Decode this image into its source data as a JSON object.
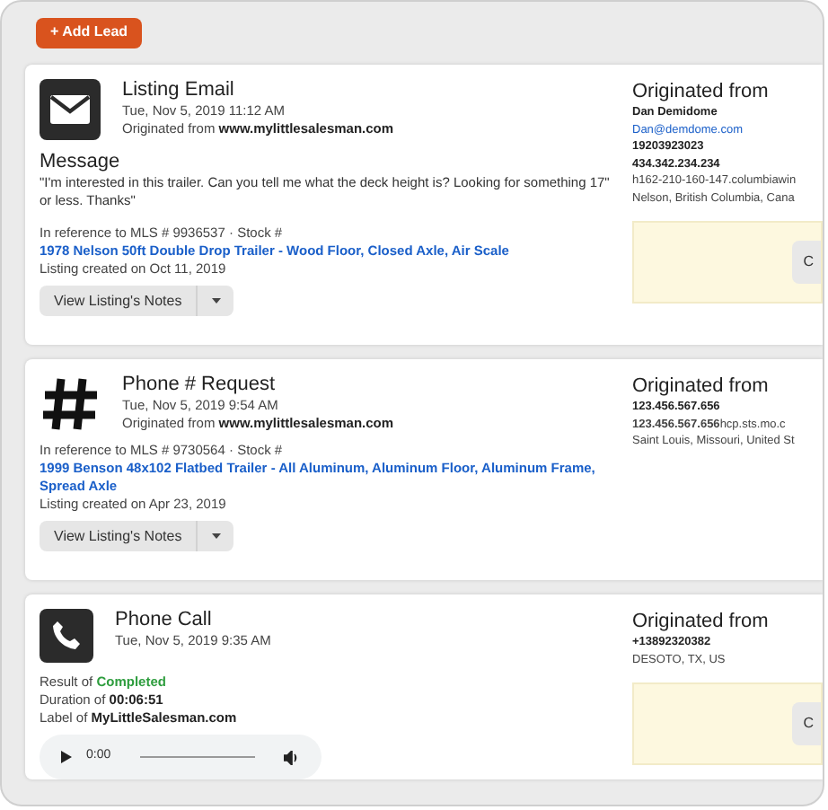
{
  "add_button": "+ Add Lead",
  "leads": [
    {
      "kind": "email",
      "title": "Listing Email",
      "date": "Tue, Nov 5, 2019 11:12 AM",
      "origin_prefix": "Originated from",
      "origin_site": "www.mylittlesalesman.com",
      "message_heading": "Message",
      "message": "\"I'm interested in this trailer. Can you tell me what the deck height is? Looking for something 17\" or less. Thanks\"",
      "reference": "In reference to MLS # 9936537 · Stock #",
      "listing_link": "1978 Nelson 50ft Double Drop Trailer - Wood Floor, Closed Axle, Air Scale",
      "listing_created": "Listing created on Oct 11, 2019",
      "notes_button": "View Listing's Notes",
      "originated_heading": "Originated from",
      "originated_lines": [
        {
          "kind": "bold",
          "text": "Dan Demidome"
        },
        {
          "kind": "link",
          "text": "Dan@demdome.com"
        },
        {
          "kind": "bold",
          "text": "19203923023"
        },
        {
          "kind": "bold",
          "text": "434.342.234.234"
        },
        {
          "kind": "plain",
          "text": "h162-210-160-147.columbiawin"
        },
        {
          "kind": "plain",
          "text": "Nelson, British Columbia, Cana"
        }
      ],
      "note_button": "C"
    },
    {
      "kind": "request",
      "title": "Phone # Request",
      "date": "Tue, Nov 5, 2019 9:54 AM",
      "origin_prefix": "Originated from",
      "origin_site": "www.mylittlesalesman.com",
      "reference": "In reference to MLS # 9730564 · Stock #",
      "listing_link": "1999 Benson 48x102 Flatbed Trailer - All Aluminum, Aluminum Floor, Aluminum Frame, Spread Axle",
      "listing_created": "Listing created on Apr 23, 2019",
      "notes_button": "View Listing's Notes",
      "originated_heading": "Originated from",
      "originated_lines": [
        {
          "kind": "bold",
          "text": "123.456.567.656"
        },
        {
          "kind": "plain",
          "text": "**123.456.567.656**hcp.sts.mo.c"
        },
        {
          "kind": "plain",
          "text": "Saint Louis, Missouri, United St"
        }
      ]
    },
    {
      "kind": "call",
      "title": "Phone Call",
      "date": "Tue, Nov 5, 2019 9:35 AM",
      "result_prefix": "Result of",
      "result": "Completed",
      "duration_prefix": "Duration of",
      "duration": "00:06:51",
      "label_prefix": "Label of",
      "label": "MyLittleSalesman.com",
      "audio_time": "0:00",
      "originated_heading": "Originated from",
      "originated_lines": [
        {
          "kind": "bold",
          "text": "+13892320382"
        },
        {
          "kind": "plain",
          "text": "DESOTO, TX, US"
        }
      ],
      "note_button": "C"
    }
  ]
}
